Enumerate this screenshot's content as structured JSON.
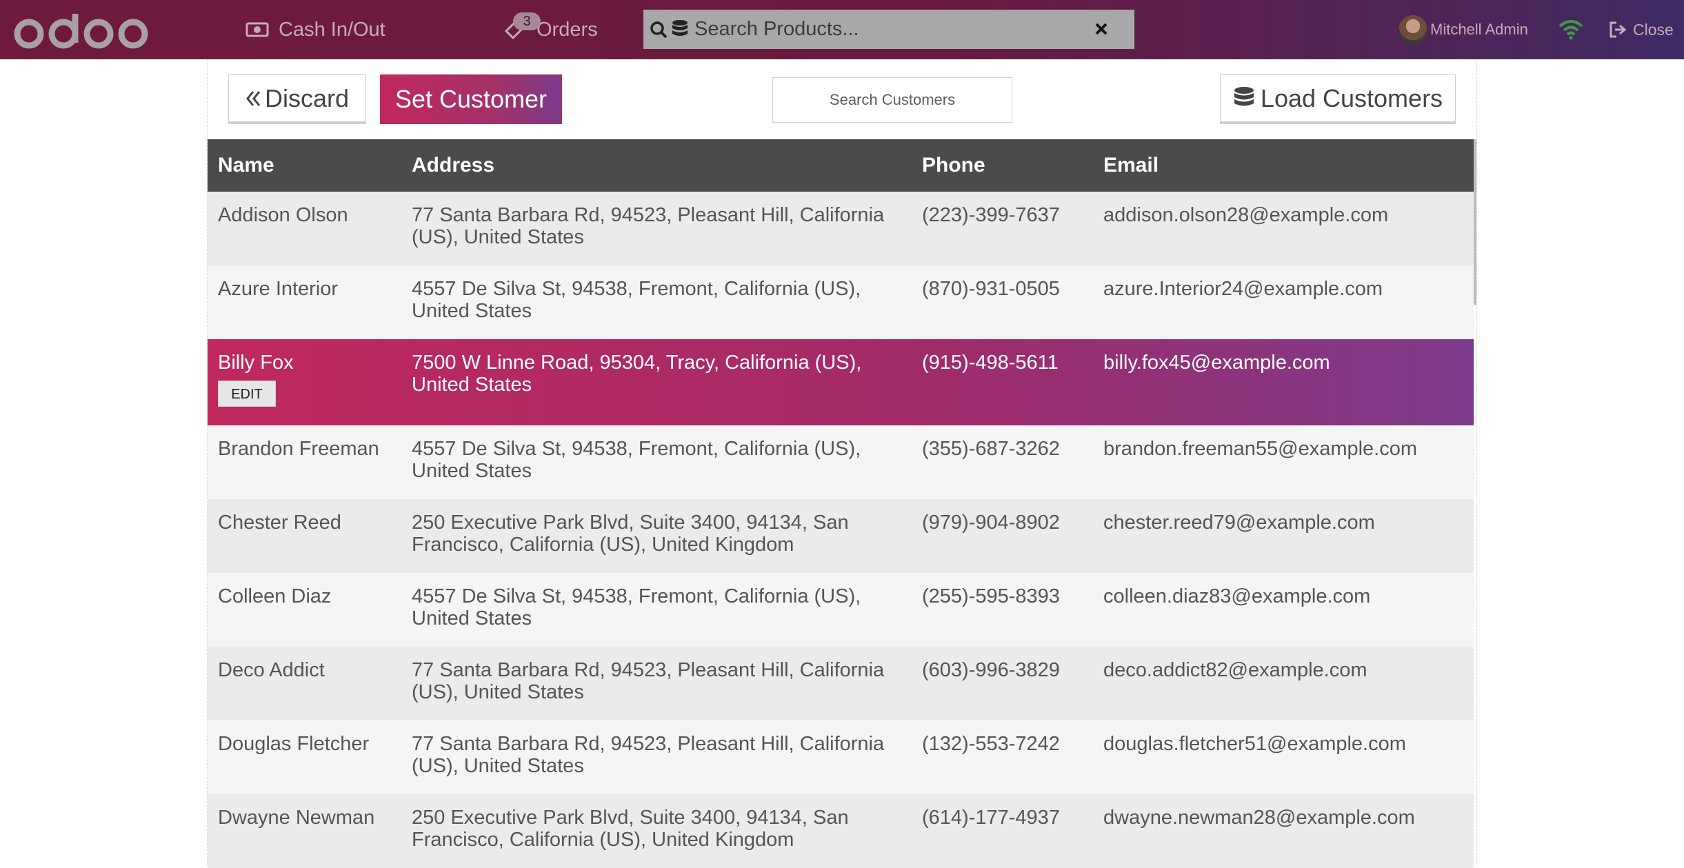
{
  "navbar": {
    "logo_text": "odoo",
    "cash_label": "Cash In/Out",
    "orders_label": "Orders",
    "orders_count": "3",
    "search_placeholder": "Search Products...",
    "user_name": "Mitchell Admin",
    "close_label": "Close",
    "wifi_color": "#3e9b3e"
  },
  "toolbar": {
    "discard_label": "Discard",
    "set_customer_label": "Set Customer",
    "search_customers_placeholder": "Search Customers",
    "load_customers_label": "Load Customers"
  },
  "table": {
    "columns": [
      "Name",
      "Address",
      "Phone",
      "Email"
    ],
    "edit_label": "EDIT",
    "selected_index": 2,
    "rows": [
      {
        "name": "Addison Olson",
        "address": "77 Santa Barbara Rd, 94523, Pleasant Hill, California (US), United States",
        "phone": "(223)-399-7637",
        "email": "addison.olson28@example.com"
      },
      {
        "name": "Azure Interior",
        "address": "4557 De Silva St, 94538, Fremont, California (US), United States",
        "phone": "(870)-931-0505",
        "email": "azure.Interior24@example.com"
      },
      {
        "name": "Billy Fox",
        "address": "7500 W Linne Road, 95304, Tracy, California (US), United States",
        "phone": "(915)-498-5611",
        "email": "billy.fox45@example.com"
      },
      {
        "name": "Brandon Freeman",
        "address": "4557 De Silva St, 94538, Fremont, California (US), United States",
        "phone": "(355)-687-3262",
        "email": "brandon.freeman55@example.com"
      },
      {
        "name": "Chester Reed",
        "address": "250 Executive Park Blvd, Suite 3400, 94134, San Francisco, California (US), United Kingdom",
        "phone": "(979)-904-8902",
        "email": "chester.reed79@example.com"
      },
      {
        "name": "Colleen Diaz",
        "address": "4557 De Silva St, 94538, Fremont, California (US), United States",
        "phone": "(255)-595-8393",
        "email": "colleen.diaz83@example.com"
      },
      {
        "name": "Deco Addict",
        "address": "77 Santa Barbara Rd, 94523, Pleasant Hill, California (US), United States",
        "phone": "(603)-996-3829",
        "email": "deco.addict82@example.com"
      },
      {
        "name": "Douglas Fletcher",
        "address": "77 Santa Barbara Rd, 94523, Pleasant Hill, California (US), United States",
        "phone": "(132)-553-7242",
        "email": "douglas.fletcher51@example.com"
      },
      {
        "name": "Dwayne Newman",
        "address": "250 Executive Park Blvd, Suite 3400, 94134, San Francisco, California (US), United Kingdom",
        "phone": "(614)-177-4937",
        "email": "dwayne.newman28@example.com"
      }
    ]
  },
  "colors": {
    "navbar_start": "#6e1a3e",
    "navbar_end": "#3f2a63",
    "accent_start": "#c0285e",
    "accent_end": "#7c3a8a",
    "header_bg": "#4b4b4b"
  }
}
